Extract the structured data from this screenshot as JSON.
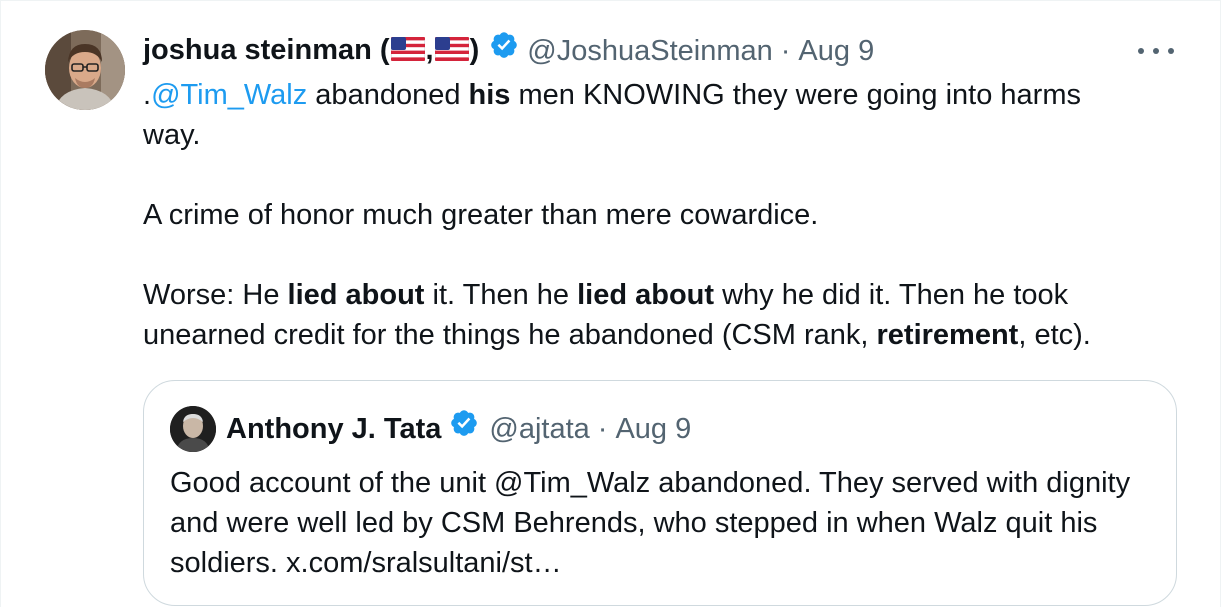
{
  "tweet": {
    "author": {
      "name": "joshua steinman (",
      "name_sep": ",",
      "name_close": ")",
      "flag_icon": "us-flag-icon",
      "handle": "@JoshuaSteinman",
      "separator": "·",
      "date": "Aug 9"
    },
    "body": {
      "line1_prefix": ".",
      "mention": "@Tim_Walz",
      "line1_a": " abandoned ",
      "line1_bold": "his",
      "line1_b": " men KNOWING they were going into harms way.",
      "para2": "A crime of honor much greater than mere cowardice.",
      "p3_a": "Worse: He ",
      "p3_bold1": "lied about",
      "p3_b": " it. Then he ",
      "p3_bold2": "lied about",
      "p3_c": " why he did it. Then he took unearned credit for the things he abandoned (CSM rank, ",
      "p3_bold3": "retirement",
      "p3_d": ", etc)."
    },
    "quoted": {
      "name": "Anthony J. Tata",
      "handle": "@ajtata",
      "separator": "·",
      "date": "Aug 9",
      "text": "Good account of the unit @Tim_Walz abandoned. They served with dignity and were well led by CSM Behrends, who stepped in when Walz quit his soldiers. x.com/sralsultani/st…"
    }
  },
  "colors": {
    "accent": "#1d9bf0",
    "secondary_text": "#536471",
    "primary_text": "#0f1419",
    "border": "#cfd9de"
  }
}
